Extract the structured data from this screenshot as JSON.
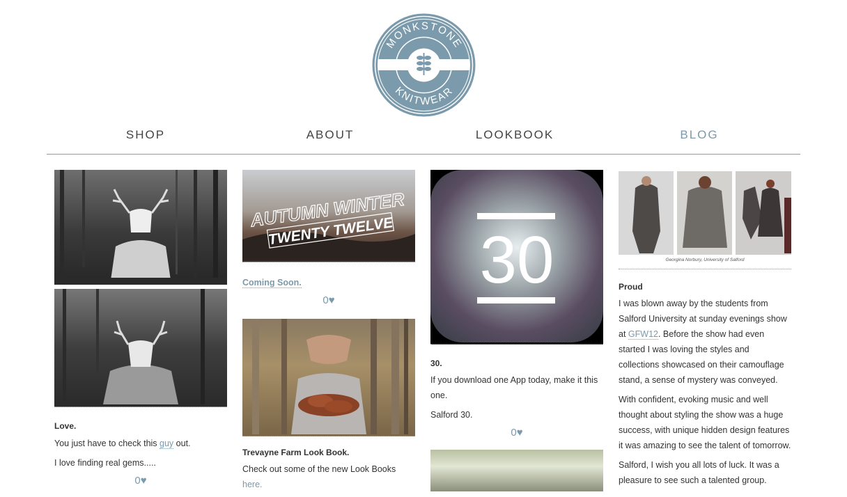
{
  "brand": {
    "line1": "MONKSTONE",
    "line2": "KNITWEAR",
    "color": "#7b9aab"
  },
  "nav": [
    {
      "label": "SHOP",
      "active": false
    },
    {
      "label": "ABOUT",
      "active": false
    },
    {
      "label": "LOOKBOOK",
      "active": false
    },
    {
      "label": "BLOG",
      "active": true
    }
  ],
  "posts": {
    "love": {
      "title": "Love.",
      "p1_before": "You just have to check this ",
      "p1_link": "guy",
      "p1_after": " out.",
      "p2": "I love finding real gems.....",
      "likes": "0"
    },
    "coming": {
      "banner_line1": "AUTUMN WINTER",
      "banner_line2": "TWENTY TWELVE",
      "link": "Coming Soon.",
      "likes": "0"
    },
    "farm": {
      "title": "Trevayne Farm Look Book.",
      "p1": "Check out some of the new Look Books",
      "p1_link": "here."
    },
    "thirty": {
      "icon_text": "30",
      "title": "30.",
      "p1": "If you download one App today, make it this one.",
      "p2": "Salford 30.",
      "likes": "0"
    },
    "proud": {
      "caption": "Georgina Norbury, University of Salford",
      "title": "Proud",
      "p1_before": "I was blown away by the students from Salford University at sunday evenings show at ",
      "p1_link": "GFW12",
      "p1_after": ". Before the show had even started I was loving the styles and collections showcased on their camouflage stand, a sense of mystery was conveyed.",
      "p2": "With confident, evoking music and well thought about styling the show was a huge success,  with unique hidden design features it was amazing to see the talent of tomorrow.",
      "p3": "Salford, I wish you all lots of luck. It was a pleasure to see such a talented group."
    }
  },
  "heart_glyph": "♥"
}
